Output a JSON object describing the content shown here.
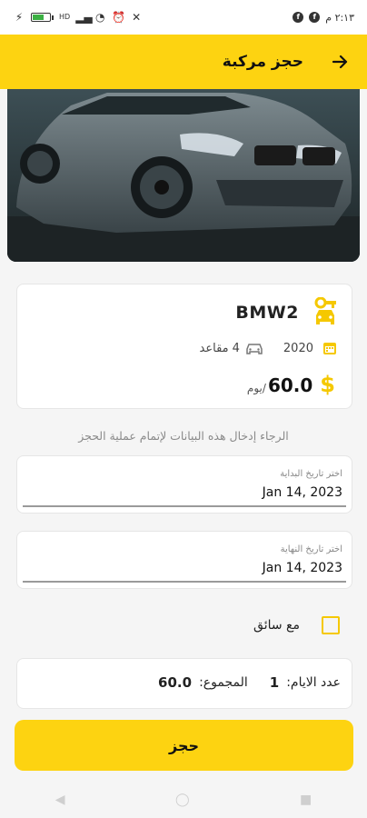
{
  "status_bar": {
    "time": "٢:١٣ م",
    "left_icons": [
      "charging-icon",
      "battery-icon",
      "hd-icon",
      "signal-icon",
      "wifi-icon",
      "alarm-icon",
      "mute-icon"
    ],
    "right_icons": [
      "app-notification-icon",
      "app-notification-icon"
    ]
  },
  "header": {
    "title": "حجز مركبة",
    "back_icon": "arrow-right-icon",
    "background": "#fdd311"
  },
  "car": {
    "name": "BMW2",
    "year": "2020",
    "seats_count": "4",
    "seats_label": "مقاعد",
    "price": "60.0",
    "per_day": "/يوم",
    "currency_icon": "$"
  },
  "form": {
    "hint": "الرجاء إدخال هذه البيانات لإتمام عملية الحجز",
    "start_label": "اختر تاريخ البداية",
    "start_value": "Jan 14, 2023",
    "end_label": "اختر تاريخ النهاية",
    "end_value": "Jan 14, 2023",
    "driver_label": "مع سائق"
  },
  "summary": {
    "days_label": "عدد الايام:",
    "days_value": "1",
    "total_label": "المجموع:",
    "total_value": "60.0"
  },
  "book_button": "حجز",
  "colors": {
    "accent": "#fdd311",
    "icon_yellow": "#f5c800"
  }
}
